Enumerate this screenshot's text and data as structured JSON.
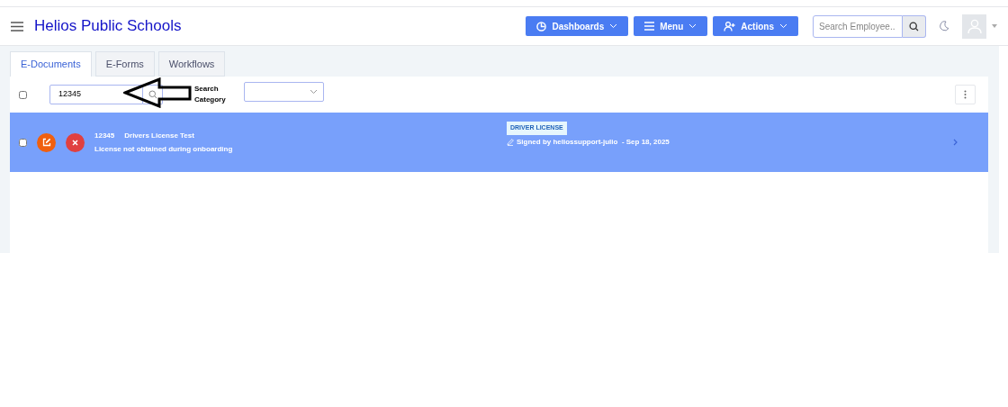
{
  "header": {
    "title": "Helios Public Schools",
    "buttons": [
      {
        "kind": "dashboards",
        "label": "Dashboards"
      },
      {
        "kind": "menu",
        "label": "Menu"
      },
      {
        "kind": "actions",
        "label": "Actions"
      }
    ],
    "search": {
      "placeholder": "Search Employee.."
    }
  },
  "tabs": [
    {
      "label": "E-Documents",
      "selected": true
    },
    {
      "label": "E-Forms",
      "selected": false
    },
    {
      "label": "Workflows",
      "selected": false
    }
  ],
  "toolbar": {
    "select_all_checked": false,
    "search_value": "12345",
    "category_label": "Search Category"
  },
  "documents": [
    {
      "checked": false,
      "selected": true,
      "number": "12345",
      "title": "Drivers License Test",
      "description": "License not obtained during onboarding",
      "tag": "DRIVER LICENSE",
      "signed": "Signed by heliossupport-julio  - Sep 18, 2025"
    }
  ]
}
